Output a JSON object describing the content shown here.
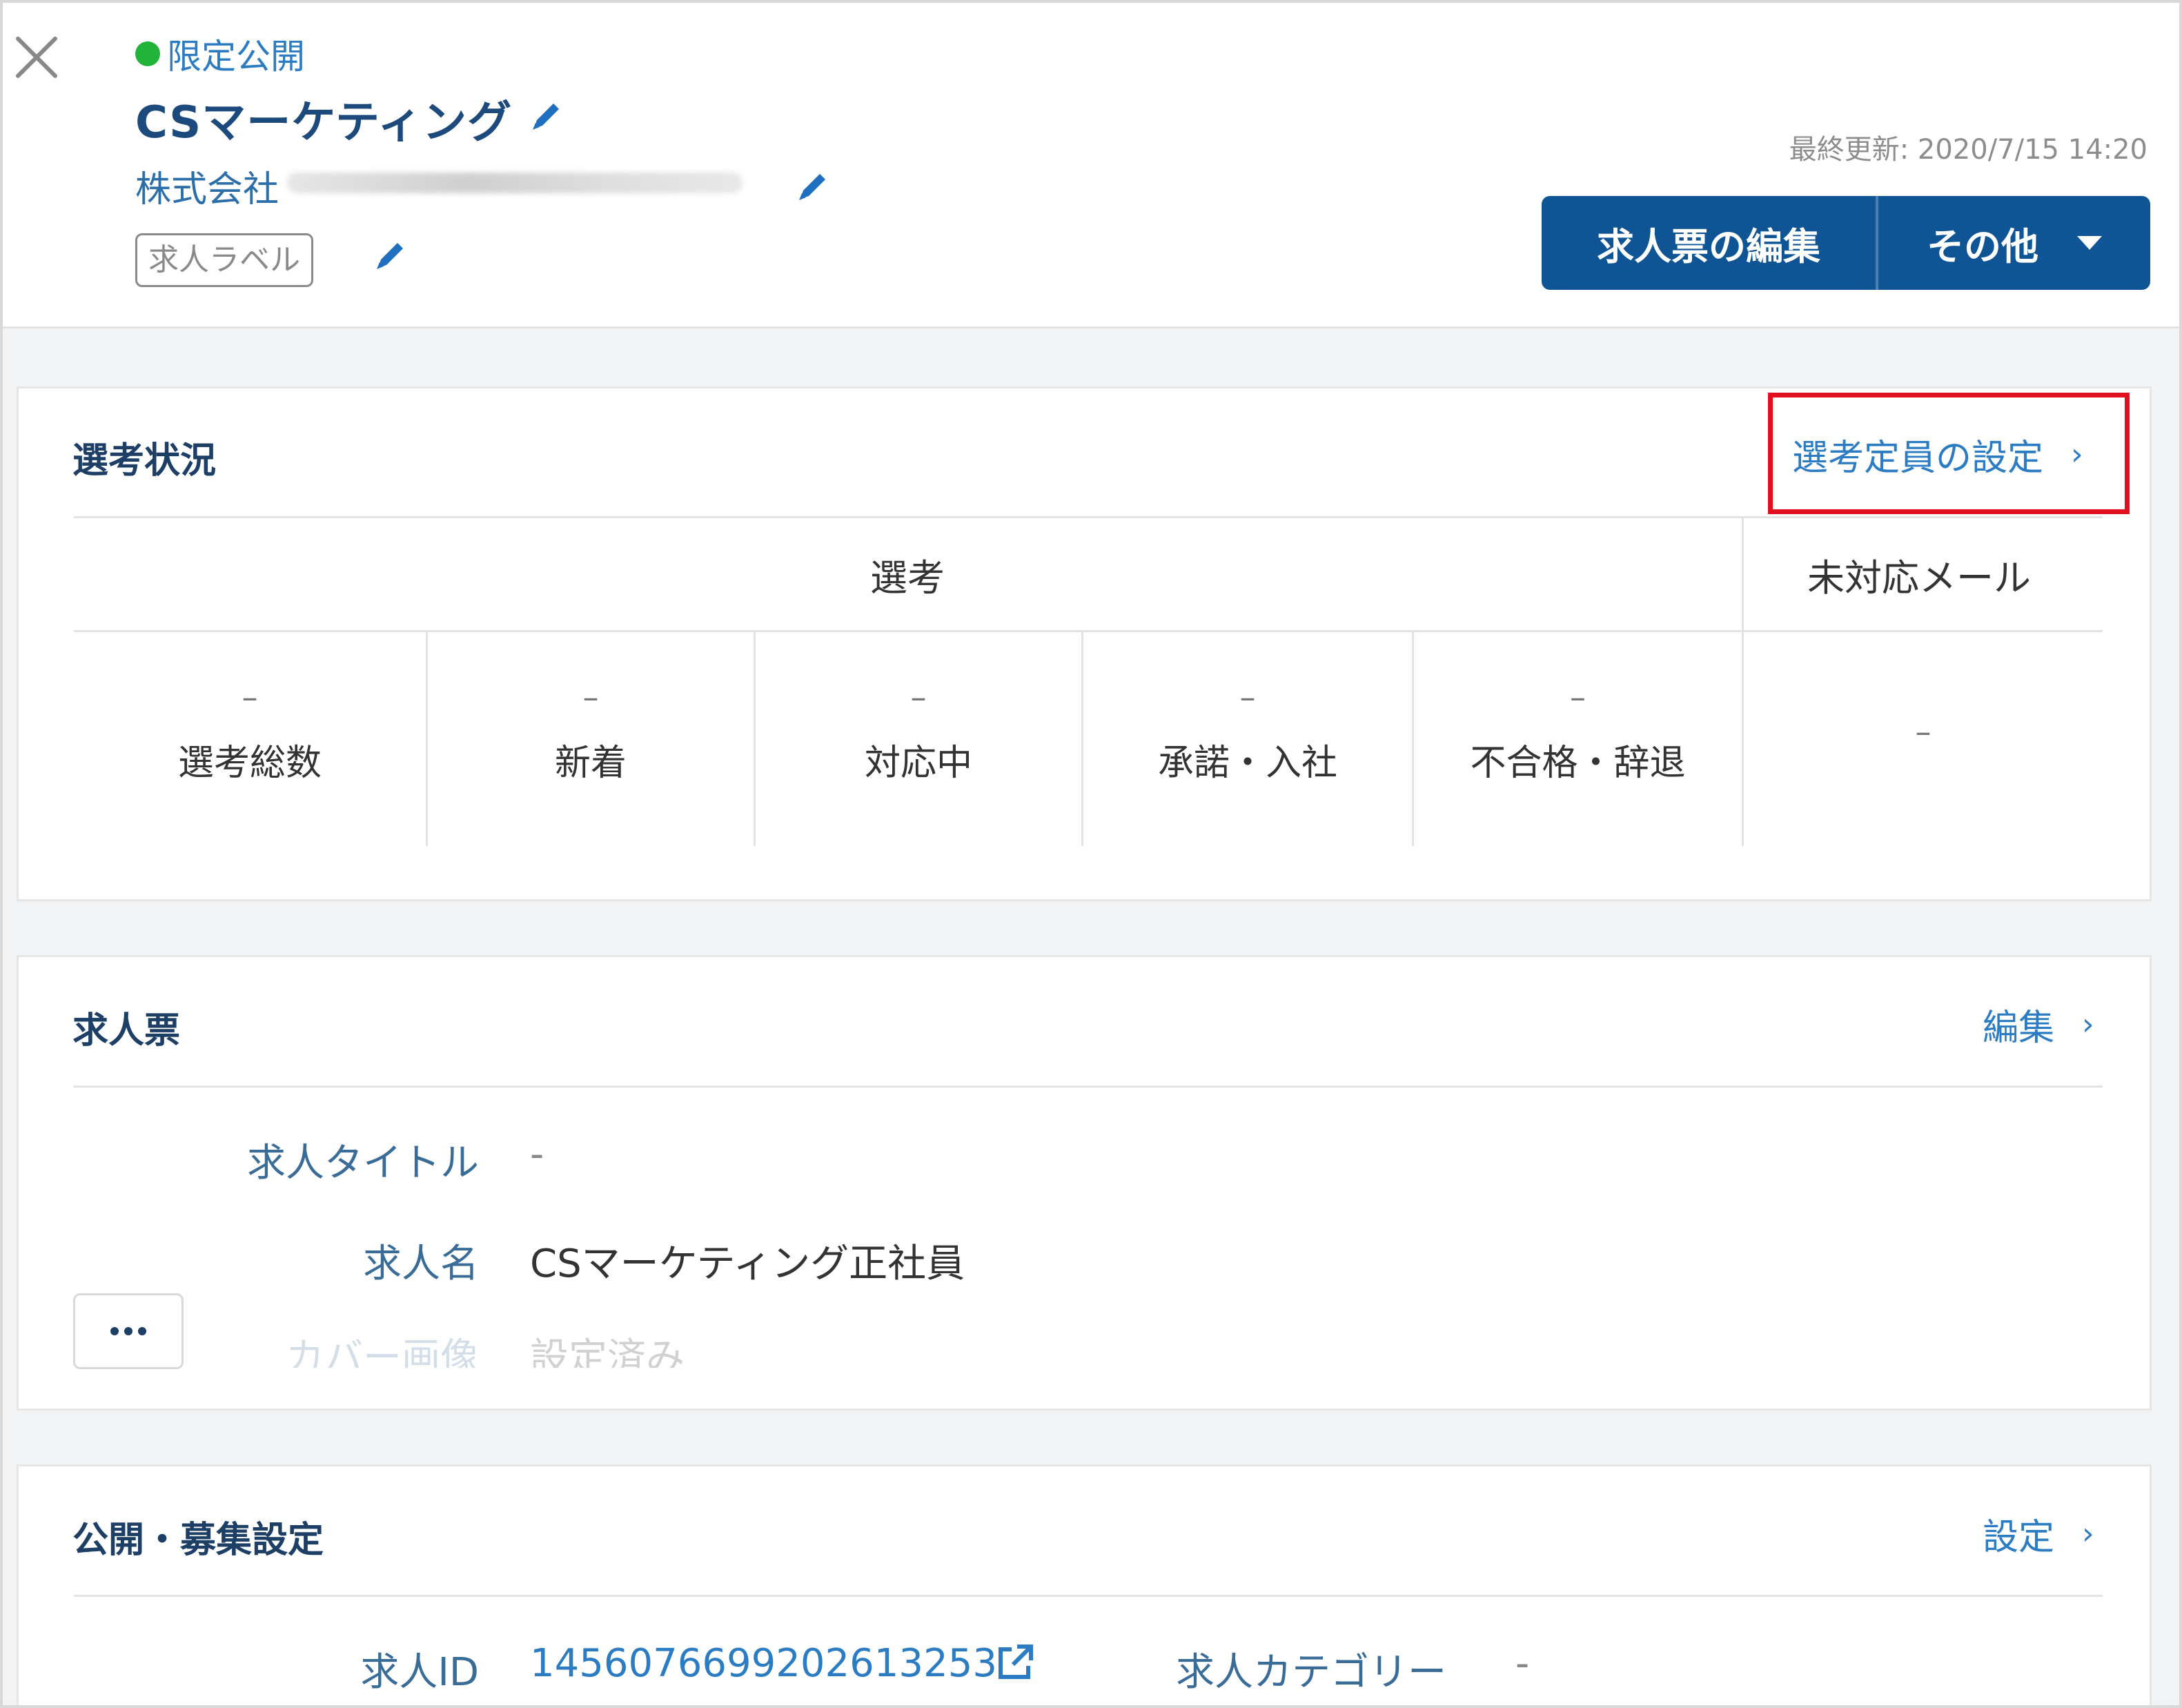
{
  "header": {
    "status_label": "限定公開",
    "job_title": "CSマーケティング",
    "company_name": "株式会社",
    "job_label": "求人ラベル",
    "last_updated": "最終更新: 2020/7/15 14:20",
    "edit_button_label": "求人票の編集",
    "more_button_label": "その他"
  },
  "selection": {
    "title": "選考状況",
    "settings_link": "選考定員の設定",
    "column_group_label": "選考",
    "unhandled_mail_label": "未対応メール",
    "stats": [
      {
        "value": "–",
        "label": "選考総数"
      },
      {
        "value": "–",
        "label": "新着"
      },
      {
        "value": "–",
        "label": "対応中"
      },
      {
        "value": "–",
        "label": "承諾・入社"
      },
      {
        "value": "–",
        "label": "不合格・辞退"
      }
    ],
    "unhandled_mail_value": "–"
  },
  "job_ticket": {
    "title": "求人票",
    "edit_link": "編集",
    "fields": [
      {
        "label": "求人タイトル",
        "value": "-"
      },
      {
        "label": "求人名",
        "value": "CSマーケティング正社員"
      },
      {
        "label": "カバー画像",
        "value": "設定済み"
      }
    ]
  },
  "publish": {
    "title": "公開・募集設定",
    "settings_link": "設定",
    "job_id_label": "求人ID",
    "job_id": "1456076699202613253",
    "category_label": "求人カテゴリー",
    "category_value": "-"
  },
  "colors": {
    "primary_button": "#0f5595",
    "link": "#2b7cc3",
    "status_dot": "#22b33a",
    "highlight_box": "#e0101f"
  },
  "icons": [
    "close-icon",
    "pencil-icon",
    "caret-down-icon",
    "chevron-right-icon",
    "external-link-icon",
    "more-icon"
  ]
}
